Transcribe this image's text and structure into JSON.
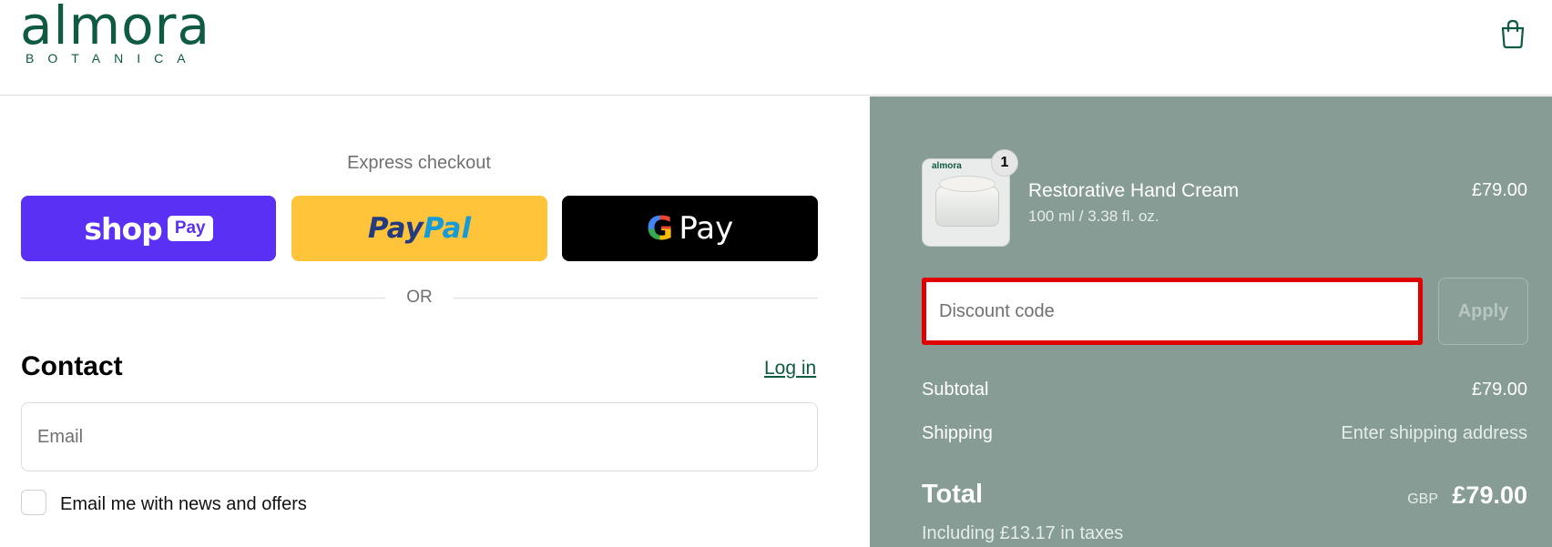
{
  "brand": {
    "name": "almora",
    "subtitle": "BOTANICA",
    "accent": "#0e5a43"
  },
  "header": {
    "cart_icon": "shopping-bag-icon"
  },
  "express": {
    "title": "Express checkout",
    "shop_pay": {
      "word": "shop",
      "tag": "Pay",
      "color": "#5a31f4"
    },
    "paypal": {
      "part1": "Pay",
      "part2": "Pal",
      "color": "#ffc439"
    },
    "gpay": {
      "g": "G",
      "word": "Pay",
      "color": "#000000"
    },
    "separator": "OR"
  },
  "contact": {
    "title": "Contact",
    "login_label": "Log in",
    "email_placeholder": "Email",
    "newsletter_label": "Email me with news and offers",
    "newsletter_checked": false
  },
  "order": {
    "item": {
      "name": "Restorative Hand Cream",
      "variant": "100 ml / 3.38 fl. oz.",
      "price": "£79.00",
      "quantity": "1",
      "thumb_label": "almora"
    },
    "discount": {
      "placeholder": "Discount code",
      "apply_label": "Apply"
    },
    "subtotal": {
      "label": "Subtotal",
      "value": "£79.00"
    },
    "shipping": {
      "label": "Shipping",
      "value": "Enter shipping address"
    },
    "total": {
      "label": "Total",
      "currency": "GBP",
      "value": "£79.00",
      "tax_note": "Including £13.17 in taxes"
    },
    "panel_color": "#869c94"
  }
}
